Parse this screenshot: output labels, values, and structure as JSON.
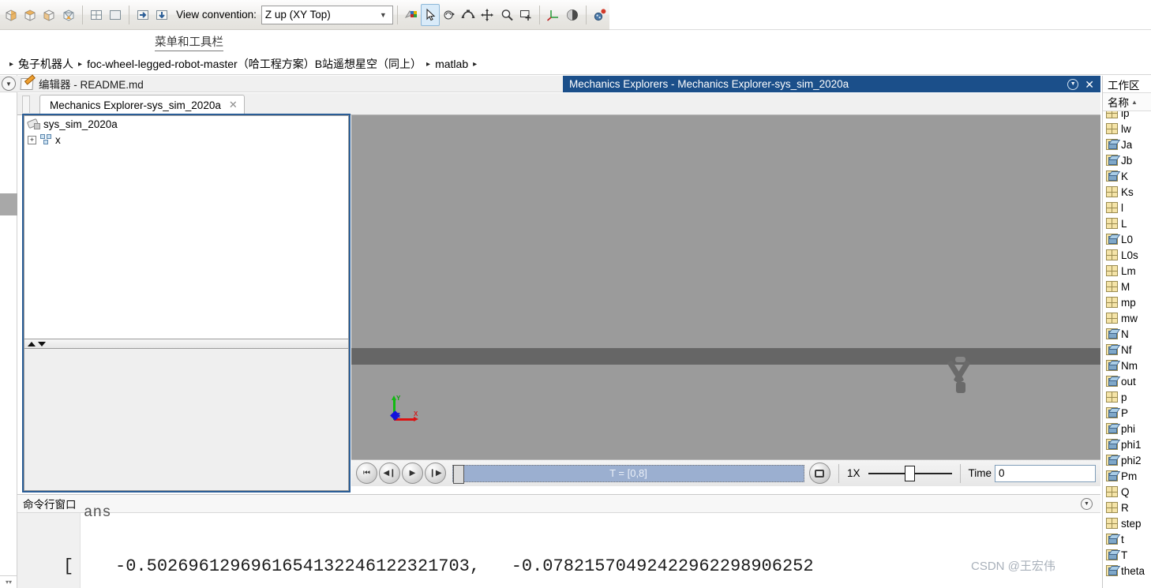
{
  "toolbar": {
    "icons_left": [
      {
        "name": "view-isometric-1-icon",
        "glyph": "iso"
      },
      {
        "name": "view-isometric-2-icon",
        "glyph": "iso"
      },
      {
        "name": "view-isometric-3-icon",
        "glyph": "iso"
      },
      {
        "name": "view-perspective-icon",
        "glyph": "persp"
      }
    ],
    "icons_layout": [
      {
        "name": "split-four-view-icon",
        "glyph": "grid4"
      },
      {
        "name": "single-view-icon",
        "glyph": "single"
      }
    ],
    "icons_dock": [
      {
        "name": "dock-right-icon",
        "glyph": "right"
      },
      {
        "name": "dock-bottom-icon",
        "glyph": "down"
      }
    ],
    "view_convention_label": "View convention:",
    "view_convention_value": "Z up (XY Top)",
    "icons_right": [
      {
        "name": "colors-icon",
        "glyph": "colors",
        "selected": false
      },
      {
        "name": "select-cursor-icon",
        "glyph": "cursor",
        "selected": true
      },
      {
        "name": "rotate-view-icon",
        "glyph": "rotate",
        "selected": false
      },
      {
        "name": "orbit-icon",
        "glyph": "orbit",
        "selected": false
      },
      {
        "name": "pan-icon",
        "glyph": "pan",
        "selected": false
      },
      {
        "name": "zoom-icon",
        "glyph": "zoom",
        "selected": false
      },
      {
        "name": "zoom-box-icon",
        "glyph": "zoombox",
        "selected": false
      },
      {
        "name": "axis-triad-icon",
        "glyph": "triad",
        "selected": false
      },
      {
        "name": "shading-icon",
        "glyph": "sphere",
        "selected": false
      },
      {
        "name": "animation-icon",
        "glyph": "anim",
        "selected": false
      }
    ]
  },
  "menu_label": "菜单和工具栏",
  "breadcrumb": {
    "items": [
      "兔子机器人",
      "foc-wheel-legged-robot-master（哈工程方案）B站遥想星空（同上）",
      "matlab"
    ],
    "separator": "▸"
  },
  "editor_dock": {
    "expand_icon": "chevron-down-circle-icon",
    "file_icon": "editor-pencil-icon",
    "title": "编辑器 - README.md"
  },
  "mechanics_window": {
    "title": "Mechanics Explorers - Mechanics Explorer-sys_sim_2020a",
    "dock_icon": "chevron-down-circle-icon",
    "close_icon": "close-icon",
    "close_label": "✕"
  },
  "tab": {
    "label": "Mechanics Explorer-sys_sim_2020a",
    "close_label": "✕"
  },
  "tree": {
    "root_label": "sys_sim_2020a",
    "root_icon": "model-icon",
    "child_label": "x",
    "child_icon": "subsystem-icon",
    "expander": "+"
  },
  "viewport": {
    "triad": {
      "x_label": "X",
      "y_label": "Y",
      "z_label": "Z",
      "x_color": "#dd1111",
      "y_color": "#11bb11",
      "z_color": "#1111dd"
    },
    "background_color": "#9b9b9b",
    "ground_color": "#666666",
    "body_color": "#6a6a6a"
  },
  "playback": {
    "buttons": [
      {
        "name": "jump-to-start-button",
        "glyph": "⏮"
      },
      {
        "name": "step-back-button",
        "glyph": "◀❙"
      },
      {
        "name": "play-button",
        "glyph": "▶"
      },
      {
        "name": "step-forward-button",
        "glyph": "❙▶"
      }
    ],
    "slider_text": "T = [0,8]",
    "snapshot_icon": "snapshot-icon",
    "speed_label": "1X",
    "time_label": "Time",
    "time_value": "0"
  },
  "command_window": {
    "title": "命令行窗口",
    "collapse_icon": "chevron-down-circle-icon",
    "clipped_line": "ans",
    "output_line": "[    -0.5026961296961654132246122321703,   -0.07821570492422962298906252"
  },
  "watermark": "CSDN @王宏伟",
  "workspace": {
    "title": "工作区",
    "column_header": "名称",
    "sort_indicator": "▲",
    "variables": [
      {
        "name": "lp",
        "type": "grid",
        "partial": true
      },
      {
        "name": "lw",
        "type": "grid"
      },
      {
        "name": "Ja",
        "type": "cube"
      },
      {
        "name": "Jb",
        "type": "cube"
      },
      {
        "name": "K",
        "type": "cube"
      },
      {
        "name": "Ks",
        "type": "grid"
      },
      {
        "name": "l",
        "type": "grid"
      },
      {
        "name": "L",
        "type": "grid"
      },
      {
        "name": "L0",
        "type": "cube"
      },
      {
        "name": "L0s",
        "type": "grid"
      },
      {
        "name": "Lm",
        "type": "grid"
      },
      {
        "name": "M",
        "type": "grid"
      },
      {
        "name": "mp",
        "type": "grid"
      },
      {
        "name": "mw",
        "type": "grid"
      },
      {
        "name": "N",
        "type": "cube"
      },
      {
        "name": "Nf",
        "type": "cube"
      },
      {
        "name": "Nm",
        "type": "cube"
      },
      {
        "name": "out",
        "type": "cube"
      },
      {
        "name": "p",
        "type": "grid"
      },
      {
        "name": "P",
        "type": "cube"
      },
      {
        "name": "phi",
        "type": "cube"
      },
      {
        "name": "phi1",
        "type": "cube"
      },
      {
        "name": "phi2",
        "type": "cube"
      },
      {
        "name": "Pm",
        "type": "cube"
      },
      {
        "name": "Q",
        "type": "grid"
      },
      {
        "name": "R",
        "type": "grid"
      },
      {
        "name": "step",
        "type": "grid"
      },
      {
        "name": "t",
        "type": "cube"
      },
      {
        "name": "T",
        "type": "cube"
      },
      {
        "name": "theta",
        "type": "cube"
      }
    ]
  }
}
